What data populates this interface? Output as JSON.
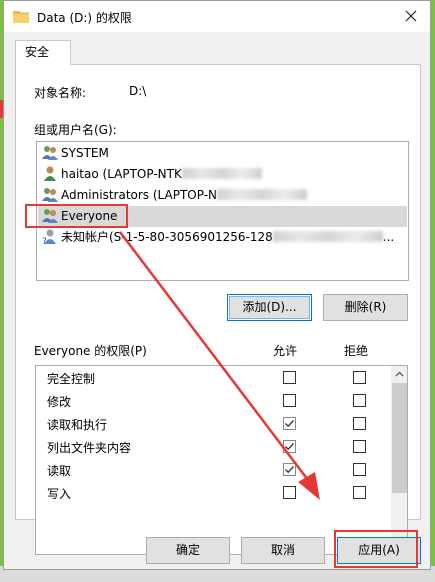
{
  "window": {
    "title": "Data (D:) 的权限"
  },
  "tabs": [
    {
      "label": "安全"
    }
  ],
  "object": {
    "label": "对象名称:",
    "value": "D:\\"
  },
  "groups": {
    "label": "组或用户名(G):",
    "items": [
      {
        "name": "SYSTEM"
      },
      {
        "name": "haitao (LAPTOP-NTK"
      },
      {
        "name": "Administrators (LAPTOP-N"
      },
      {
        "name": "Everyone"
      },
      {
        "name": "未知帐户(S-1-5-80-3056901256-128",
        "suffix": "..."
      }
    ]
  },
  "buttons": {
    "add": "添加(D)...",
    "remove": "删除(R)",
    "ok": "确定",
    "cancel": "取消",
    "apply": "应用(A)"
  },
  "permissions": {
    "label": "Everyone 的权限(P)",
    "allow_header": "允许",
    "deny_header": "拒绝",
    "rows": [
      {
        "name": "完全控制",
        "allow": false,
        "deny": false
      },
      {
        "name": "修改",
        "allow": false,
        "deny": false
      },
      {
        "name": "读取和执行",
        "allow": true,
        "deny": false
      },
      {
        "name": "列出文件夹内容",
        "allow": true,
        "deny": false
      },
      {
        "name": "读取",
        "allow": true,
        "deny": false
      },
      {
        "name": "写入",
        "allow": false,
        "deny": false
      }
    ]
  },
  "colors": {
    "accent": "#0078d7",
    "highlight": "#e53935",
    "selected": "#d9d9d9"
  }
}
